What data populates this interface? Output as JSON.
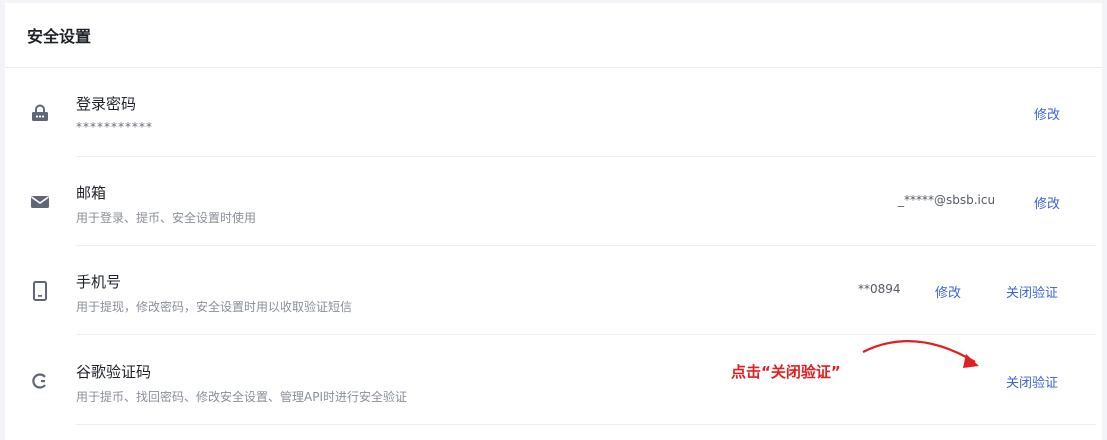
{
  "section_title": "安全设置",
  "rows": [
    {
      "icon": "lock-icon",
      "title": "登录密码",
      "desc": "***********",
      "value": "",
      "actions": [
        "修改"
      ]
    },
    {
      "icon": "mail-icon",
      "title": "邮箱",
      "desc": "用于登录、提币、安全设置时使用",
      "value": "_*****@sbsb.icu",
      "actions": [
        "修改"
      ]
    },
    {
      "icon": "phone-icon",
      "title": "手机号",
      "desc": "用于提现，修改密码，安全设置时用以收取验证短信",
      "value": "**0894",
      "actions": [
        "修改",
        "关闭验证"
      ]
    },
    {
      "icon": "google-authenticator-icon",
      "title": "谷歌验证码",
      "desc": "用于提币、找回密码、修改安全设置、管理API时进行安全验证",
      "value": "",
      "actions": [
        "关闭验证"
      ]
    }
  ],
  "annotation": {
    "text": "点击“关闭验证”",
    "color": "#e02020"
  },
  "colors": {
    "link": "#3b63d8",
    "icon": "#5f6675",
    "annotation": "#e02020"
  }
}
